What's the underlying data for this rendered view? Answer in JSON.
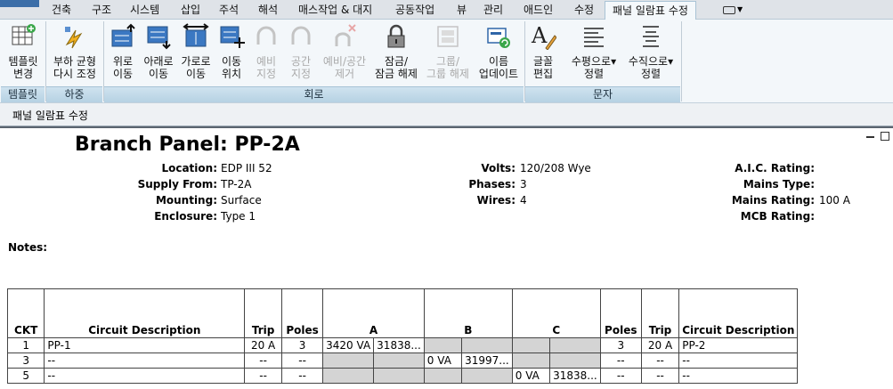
{
  "tabs": [
    "건축",
    "구조",
    "시스템",
    "삽입",
    "주석",
    "해석",
    "매스작업 & 대지",
    "공동작업",
    "뷰",
    "관리",
    "애드인",
    "수정",
    "패널 일람표 수정"
  ],
  "ribbon": {
    "buttons": [
      {
        "label1": "템플릿",
        "label2": "변경"
      },
      {
        "label1": "부하 균형",
        "label2": "다시 조정"
      },
      {
        "label1": "위로",
        "label2": "이동"
      },
      {
        "label1": "아래로",
        "label2": "이동"
      },
      {
        "label1": "가로로",
        "label2": "이동"
      },
      {
        "label1": "이동",
        "label2": "위치"
      },
      {
        "label1": "예비",
        "label2": "지정"
      },
      {
        "label1": "공간",
        "label2": "지정"
      },
      {
        "label1": "예비/공간",
        "label2": "제거"
      },
      {
        "label1": "잠금/",
        "label2": "잠금 해제"
      },
      {
        "label1": "그룹/",
        "label2": "그룹 해제"
      },
      {
        "label1": "이름",
        "label2": "업데이트"
      },
      {
        "label1": "글꼴",
        "label2": "편집"
      },
      {
        "label1": "수평으로",
        "label2": "정렬"
      },
      {
        "label1": "수직으로",
        "label2": "정렬"
      }
    ],
    "groups": [
      "템플릿",
      "하중",
      "회로",
      "문자"
    ]
  },
  "context_title": "패널 일람표 수정",
  "panel": {
    "title": "Branch Panel: PP-2A",
    "fields": {
      "location_label": "Location:",
      "location": "EDP III 52",
      "supply_label": "Supply From:",
      "supply": "TP-2A",
      "mounting_label": "Mounting:",
      "mounting": "Surface",
      "enclosure_label": "Enclosure:",
      "enclosure": "Type 1",
      "volts_label": "Volts:",
      "volts": "120/208 Wye",
      "phases_label": "Phases:",
      "phases": "3",
      "wires_label": "Wires:",
      "wires": "4",
      "aic_label": "A.I.C. Rating:",
      "aic": "",
      "mains_type_label": "Mains Type:",
      "mains_type": "",
      "mains_rating_label": "Mains Rating:",
      "mains_rating": "100 A",
      "mcb_label": "MCB Rating:",
      "mcb": ""
    },
    "notes_label": "Notes:"
  },
  "table": {
    "headers": [
      "CKT",
      "Circuit Description",
      "Trip",
      "Poles",
      "A",
      "B",
      "C",
      "Poles",
      "Trip",
      "Circuit Description"
    ],
    "rows": [
      {
        "ckt": "1",
        "desc": "PP-1",
        "trip": "20 A",
        "poles": "3",
        "a1": "3420 VA",
        "a2": "31838...",
        "b1": "",
        "b2": "",
        "c1": "",
        "c2": "",
        "poles2": "3",
        "trip2": "20 A",
        "desc2": "PP-2"
      },
      {
        "ckt": "3",
        "desc": "--",
        "trip": "--",
        "poles": "--",
        "a1": "",
        "a2": "",
        "b1": "0 VA",
        "b2": "31997...",
        "c1": "",
        "c2": "",
        "poles2": "--",
        "trip2": "--",
        "desc2": "--"
      },
      {
        "ckt": "5",
        "desc": "--",
        "trip": "--",
        "poles": "--",
        "a1": "",
        "a2": "",
        "b1": "",
        "b2": "",
        "c1": "0 VA",
        "c2": "31838...",
        "poles2": "--",
        "trip2": "--",
        "desc2": "--"
      }
    ]
  }
}
